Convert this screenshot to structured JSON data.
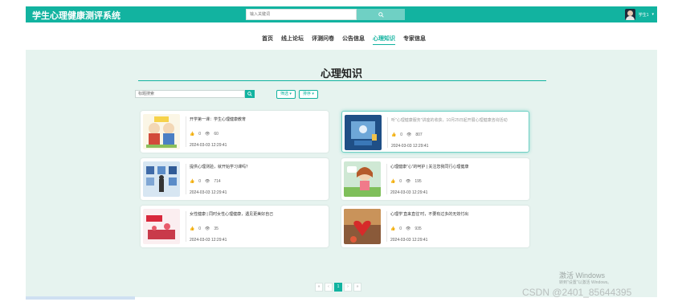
{
  "header": {
    "title": "学生心理健康测评系统",
    "search_placeholder": "输入关键词",
    "user_name": "学生1",
    "user_caret": "▾",
    "search_icon": "search-icon"
  },
  "nav": {
    "items": [
      {
        "label": "首页"
      },
      {
        "label": "线上论坛"
      },
      {
        "label": "评测问卷"
      },
      {
        "label": "公告信息"
      },
      {
        "label": "心理知识",
        "active": true
      },
      {
        "label": "专家信息"
      }
    ]
  },
  "section": {
    "title": "心理知识"
  },
  "filters": {
    "search_placeholder": "标题搜索",
    "filter_label": "筛选 ▾",
    "sort_label": "排序 ▾"
  },
  "cards": [
    {
      "title": "开学第一课：学生心理健康教育",
      "likes": "0",
      "views": "60",
      "date": "2024-03-03 12:29:41"
    },
    {
      "title": "听\"心理健康服务\"讲座的收获，10月25日起开展心理健康咨询活动",
      "likes": "0",
      "views": "807",
      "date": "2024-03-03 12:29:41"
    },
    {
      "title": "提供心理测验，就开始学习课吗？",
      "likes": "0",
      "views": "714",
      "date": "2024-03-03 12:29:41"
    },
    {
      "title": "心理健康“心”的呵护 | 关注您我同行心理健康",
      "likes": "0",
      "views": "195",
      "date": "2024-03-03 12:29:41"
    },
    {
      "title": "女性健康 | 同时女性心理健康，遇见更美好自己",
      "likes": "0",
      "views": "35",
      "date": "2024-03-03 12:29:41"
    },
    {
      "title": "心理学‘直来直往’时，不要有过多的无效付出",
      "likes": "0",
      "views": "935",
      "date": "2024-03-03 12:29:41"
    }
  ],
  "pagination": {
    "first": "«",
    "prev": "‹",
    "current": "1",
    "next": "›",
    "last": "»"
  },
  "overlay": {
    "activate_title": "激活 Windows",
    "activate_sub": "转到\"设置\"以激活 Windows。",
    "watermark": "CSDN @2401_85644395"
  },
  "colors": {
    "accent": "#12b3a0",
    "background": "#e6f3ef"
  }
}
